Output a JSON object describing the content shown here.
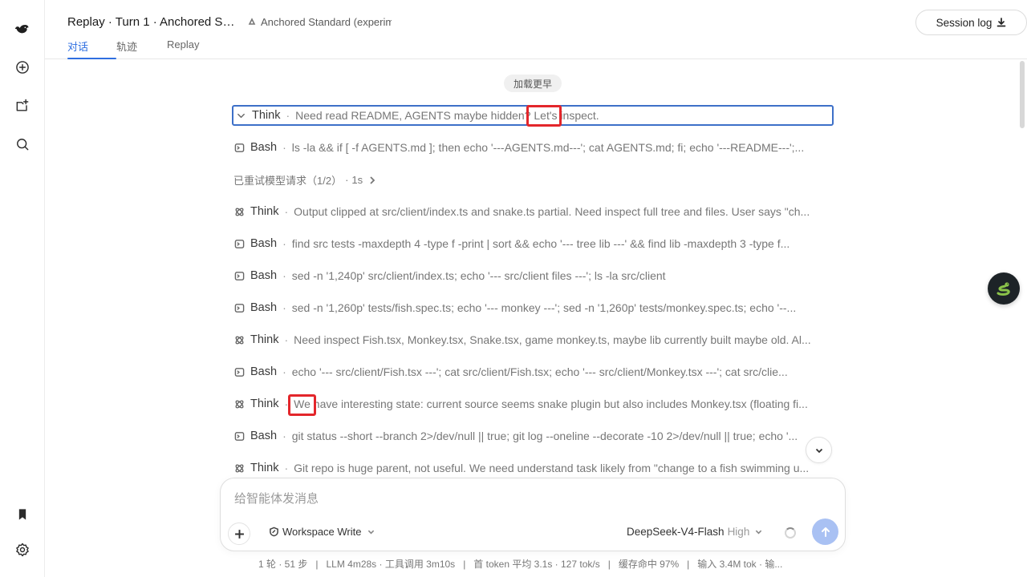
{
  "window": {
    "title": "Replay · Turn 1 · Anchored St...",
    "mode": "Anchored Standard (experim",
    "session_log": "Session log"
  },
  "tabs": [
    "对话",
    "轨迹",
    "Replay"
  ],
  "active_tab": 0,
  "load_earlier": "加载更早",
  "retry": {
    "label": "已重试模型请求（1/2）",
    "sep": "·",
    "time": "1s"
  },
  "rows": [
    {
      "kind": "Think",
      "icon": "chevron-down-icon",
      "text": "Need read README, AGENTS maybe hidden? Let's inspect.",
      "selected": true
    },
    {
      "kind": "Bash",
      "icon": "terminal-icon",
      "text": "ls -la && if [ -f AGENTS.md ]; then echo '---AGENTS.md---'; cat AGENTS.md; fi; echo '---README---';..."
    },
    {
      "kind": "Think",
      "icon": "atom-icon",
      "text": "Output clipped at src/client/index.ts and snake.ts partial. Need inspect full tree and files. User says \"ch..."
    },
    {
      "kind": "Bash",
      "icon": "terminal-icon",
      "text": "find src tests -maxdepth 4 -type f -print | sort && echo '--- tree lib ---' && find lib -maxdepth 3 -type f..."
    },
    {
      "kind": "Bash",
      "icon": "terminal-icon",
      "text": "sed -n '1,240p' src/client/index.ts; echo '--- src/client files ---'; ls -la src/client"
    },
    {
      "kind": "Bash",
      "icon": "terminal-icon",
      "text": "sed -n '1,260p' tests/fish.spec.ts; echo '--- monkey ---'; sed -n '1,260p' tests/monkey.spec.ts; echo '--..."
    },
    {
      "kind": "Think",
      "icon": "atom-icon",
      "text": "Need inspect Fish.tsx, Monkey.tsx, Snake.tsx, game monkey.ts, maybe lib currently built maybe old. Al..."
    },
    {
      "kind": "Bash",
      "icon": "terminal-icon",
      "text": "echo '--- src/client/Fish.tsx ---'; cat src/client/Fish.tsx; echo '--- src/client/Monkey.tsx ---'; cat src/clie..."
    },
    {
      "kind": "Think",
      "icon": "atom-icon",
      "text": "We have interesting state: current source seems snake plugin but also includes Monkey.tsx (floating fi..."
    },
    {
      "kind": "Bash",
      "icon": "terminal-icon",
      "text": "git status --short --branch 2>/dev/null || true; git log --oneline --decorate -10 2>/dev/null || true; echo '..."
    },
    {
      "kind": "Think",
      "icon": "atom-icon",
      "text": "Git repo is huge parent, not useful. We need understand task likely from \"change to a fish swimming u..."
    }
  ],
  "composer": {
    "placeholder": "给智能体发消息",
    "workspace": "Workspace Write",
    "model": "DeepSeek-V4-Flash",
    "level": "High"
  },
  "status_bar": "1 轮 · 51 步   |   LLM 4m28s · 工具调用 3m10s   |   首 token 平均 3.1s · 127 tok/s   |   缓存命中 97%   |   输入 3.4M tok · 输...",
  "colors": {
    "accent": "#2f6fe0",
    "selection_border": "#3d70c8",
    "highlight": "#e3262b",
    "send_button": "#a9c1f3"
  }
}
